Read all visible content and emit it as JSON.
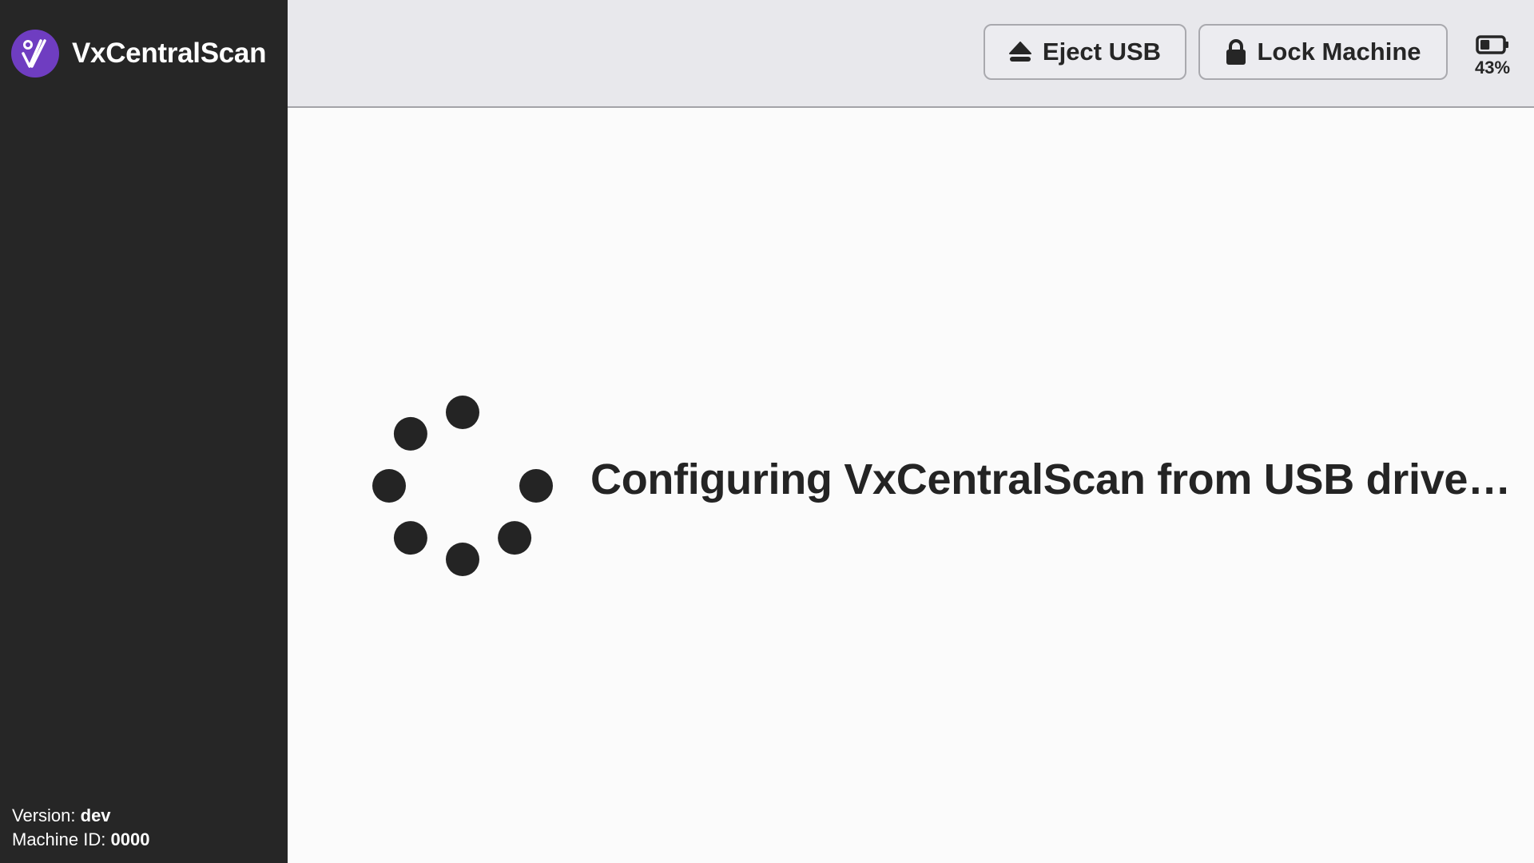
{
  "app": {
    "title": "VxCentralScan",
    "logo_icon": "vx-logo-icon",
    "brand_color": "#6f3dc1"
  },
  "sidebar": {
    "version_label": "Version:",
    "version_value": "dev",
    "machine_id_label": "Machine ID:",
    "machine_id_value": "0000"
  },
  "header": {
    "eject_label": "Eject USB",
    "eject_icon": "eject-icon",
    "lock_label": "Lock Machine",
    "lock_icon": "lock-icon",
    "battery_percent": "43%",
    "battery_level": 0.43,
    "battery_icon": "battery-icon"
  },
  "main": {
    "loading_message": "Configuring VxCentralScan from USB drive…",
    "spinner_icon": "loading-spinner-icon"
  },
  "colors": {
    "sidebar_bg": "#262626",
    "header_bg": "#e8e8ec",
    "main_bg": "#fbfbfb",
    "text": "#242424"
  }
}
